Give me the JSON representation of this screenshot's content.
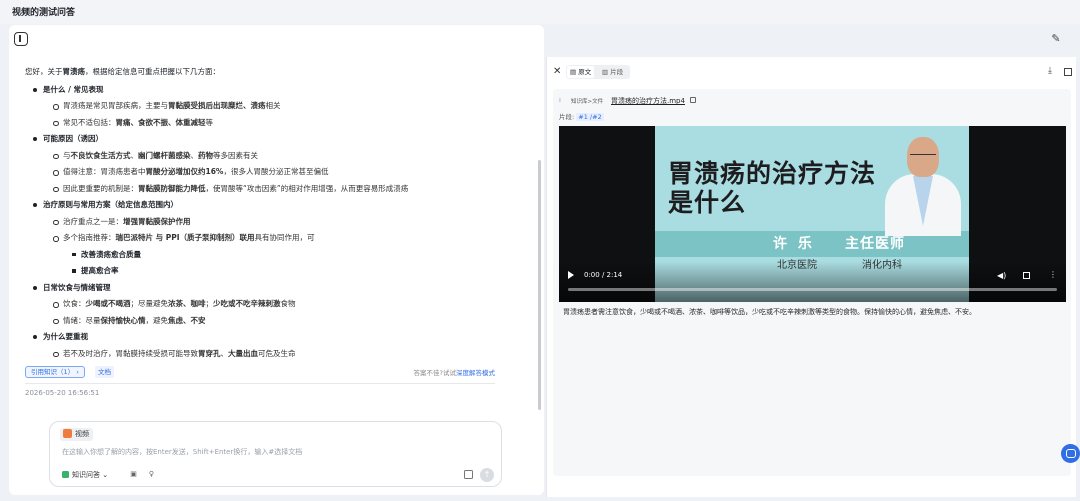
{
  "app": {
    "title": "视频的测试问答"
  },
  "answer": {
    "intro_prefix": "您好，关于",
    "intro_topic": "胃溃疡",
    "intro_suffix": "，根据给定信息可重点把握以下几方面：",
    "sections": [
      {
        "heading": "是什么 / 常见表现",
        "bullets": [
          [
            {
              "t": "胃溃疡是常见胃部疾病，主要与"
            },
            {
              "t": "胃黏膜受损后出现糜烂、溃疡",
              "b": true
            },
            {
              "t": "相关"
            }
          ],
          [
            {
              "t": "常见不适包括："
            },
            {
              "t": "胃痛、食欲不振、体重减轻",
              "b": true
            },
            {
              "t": "等"
            }
          ]
        ]
      },
      {
        "heading": "可能原因（诱因）",
        "bullets": [
          [
            {
              "t": "与"
            },
            {
              "t": "不良饮食生活方式",
              "b": true
            },
            {
              "t": "、"
            },
            {
              "t": "幽门螺杆菌感染",
              "b": true
            },
            {
              "t": "、"
            },
            {
              "t": "药物",
              "b": true
            },
            {
              "t": "等多因素有关"
            }
          ],
          [
            {
              "t": "值得注意：胃溃疡患者中"
            },
            {
              "t": "胃酸分泌增加仅约16%",
              "b": true
            },
            {
              "t": "，很多人胃酸分泌正常甚至偏低"
            }
          ],
          [
            {
              "t": "因此更重要的机制是："
            },
            {
              "t": "胃黏膜防御能力降低",
              "b": true
            },
            {
              "t": "，使胃酸等“攻击因素”的相对作用增强，从而更容易形成溃疡"
            }
          ]
        ]
      },
      {
        "heading": "治疗原则与常用方案（给定信息范围内）",
        "bullets": [
          [
            {
              "t": "治疗重点之一是："
            },
            {
              "t": "增强胃黏膜保护作用",
              "b": true
            }
          ],
          [
            {
              "t": "多个指南推荐："
            },
            {
              "t": "瑞巴派特片 与 PPI（质子泵抑制剂）联用",
              "b": true
            },
            {
              "t": "具有协同作用，可"
            }
          ]
        ],
        "subbullets": [
          "改善溃疡愈合质量",
          "提高愈合率"
        ]
      },
      {
        "heading": "日常饮食与情绪管理",
        "bullets": [
          [
            {
              "t": "饮食："
            },
            {
              "t": "少喝或不喝酒",
              "b": true
            },
            {
              "t": "；尽量避免"
            },
            {
              "t": "浓茶、咖啡",
              "b": true
            },
            {
              "t": "；"
            },
            {
              "t": "少吃或不吃辛辣刺激",
              "b": true
            },
            {
              "t": "食物"
            }
          ],
          [
            {
              "t": "情绪：尽量"
            },
            {
              "t": "保持愉快心情",
              "b": true
            },
            {
              "t": "，避免"
            },
            {
              "t": "焦虑、不安",
              "b": true
            }
          ]
        ]
      },
      {
        "heading": "为什么要重视",
        "bullets": [
          [
            {
              "t": "若不及时治疗，胃黏膜持续受损可能导致"
            },
            {
              "t": "胃穿孔",
              "b": true
            },
            {
              "t": "、"
            },
            {
              "t": "大量出血",
              "b": true
            },
            {
              "t": "可危及生命"
            }
          ]
        ]
      }
    ]
  },
  "refs": {
    "cite_label": "引用知识（1）",
    "doc_label": "文档",
    "hint_prefix": "答案不佳?试试",
    "hint_link": "深度解答模式"
  },
  "timestamp": "2026-05-20 16:56:51",
  "input": {
    "skill_label": "视频",
    "placeholder": "在这输入你想了解的内容，按Enter发送，Shift+Enter换行，输入#选择文档",
    "kb_label": "知识问答"
  },
  "preview": {
    "tab_original": "原文",
    "tab_segment": "片段",
    "source_path": "知识库>文件",
    "file_name": "胃溃疡的治疗方法.mp4",
    "segment_label": "片段:",
    "segment_value": "#1 /#2",
    "video": {
      "title_line1": "胃溃疡的治疗方法",
      "title_line2": "是什么",
      "doctor_name": "许 乐",
      "doctor_role": "主任医师",
      "hospital": "北京医院",
      "department": "消化内科",
      "time": "0:00 / 2:14",
      "progress": 0
    },
    "transcript": "胃溃疡患者需注意饮食，少喝或不喝酒、浓茶、咖啡等饮品，少吃或不吃辛辣刺激等类型的食物。保持愉快的心情，避免焦虑、不安。"
  },
  "colors": {
    "accent": "#2f6ee5",
    "video_bg": "#a9dde1",
    "banner": "#7cc3c5"
  }
}
